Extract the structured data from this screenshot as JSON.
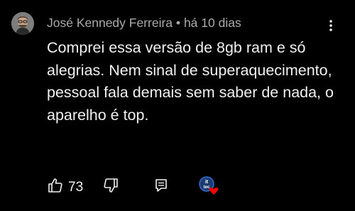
{
  "comment": {
    "author": "José Kennedy Ferreira",
    "separator": "•",
    "time": "há 10 dias",
    "text": "Comprei essa versão de 8gb ram e só alegrias. Nem sinal de superaquecimento, pessoal fala demais sem saber de nada, o aparelho é top.",
    "like_count": "73"
  },
  "icons": {
    "like": "thumbs-up-icon",
    "dislike": "thumbs-down-icon",
    "reply": "reply-icon",
    "menu": "more-vertical-icon",
    "creator_heart": "creator-heart-icon"
  },
  "colors": {
    "background": "#000000",
    "text": "#f1f1f1",
    "meta": "#aaaaaa",
    "heart": "#ff0000"
  }
}
